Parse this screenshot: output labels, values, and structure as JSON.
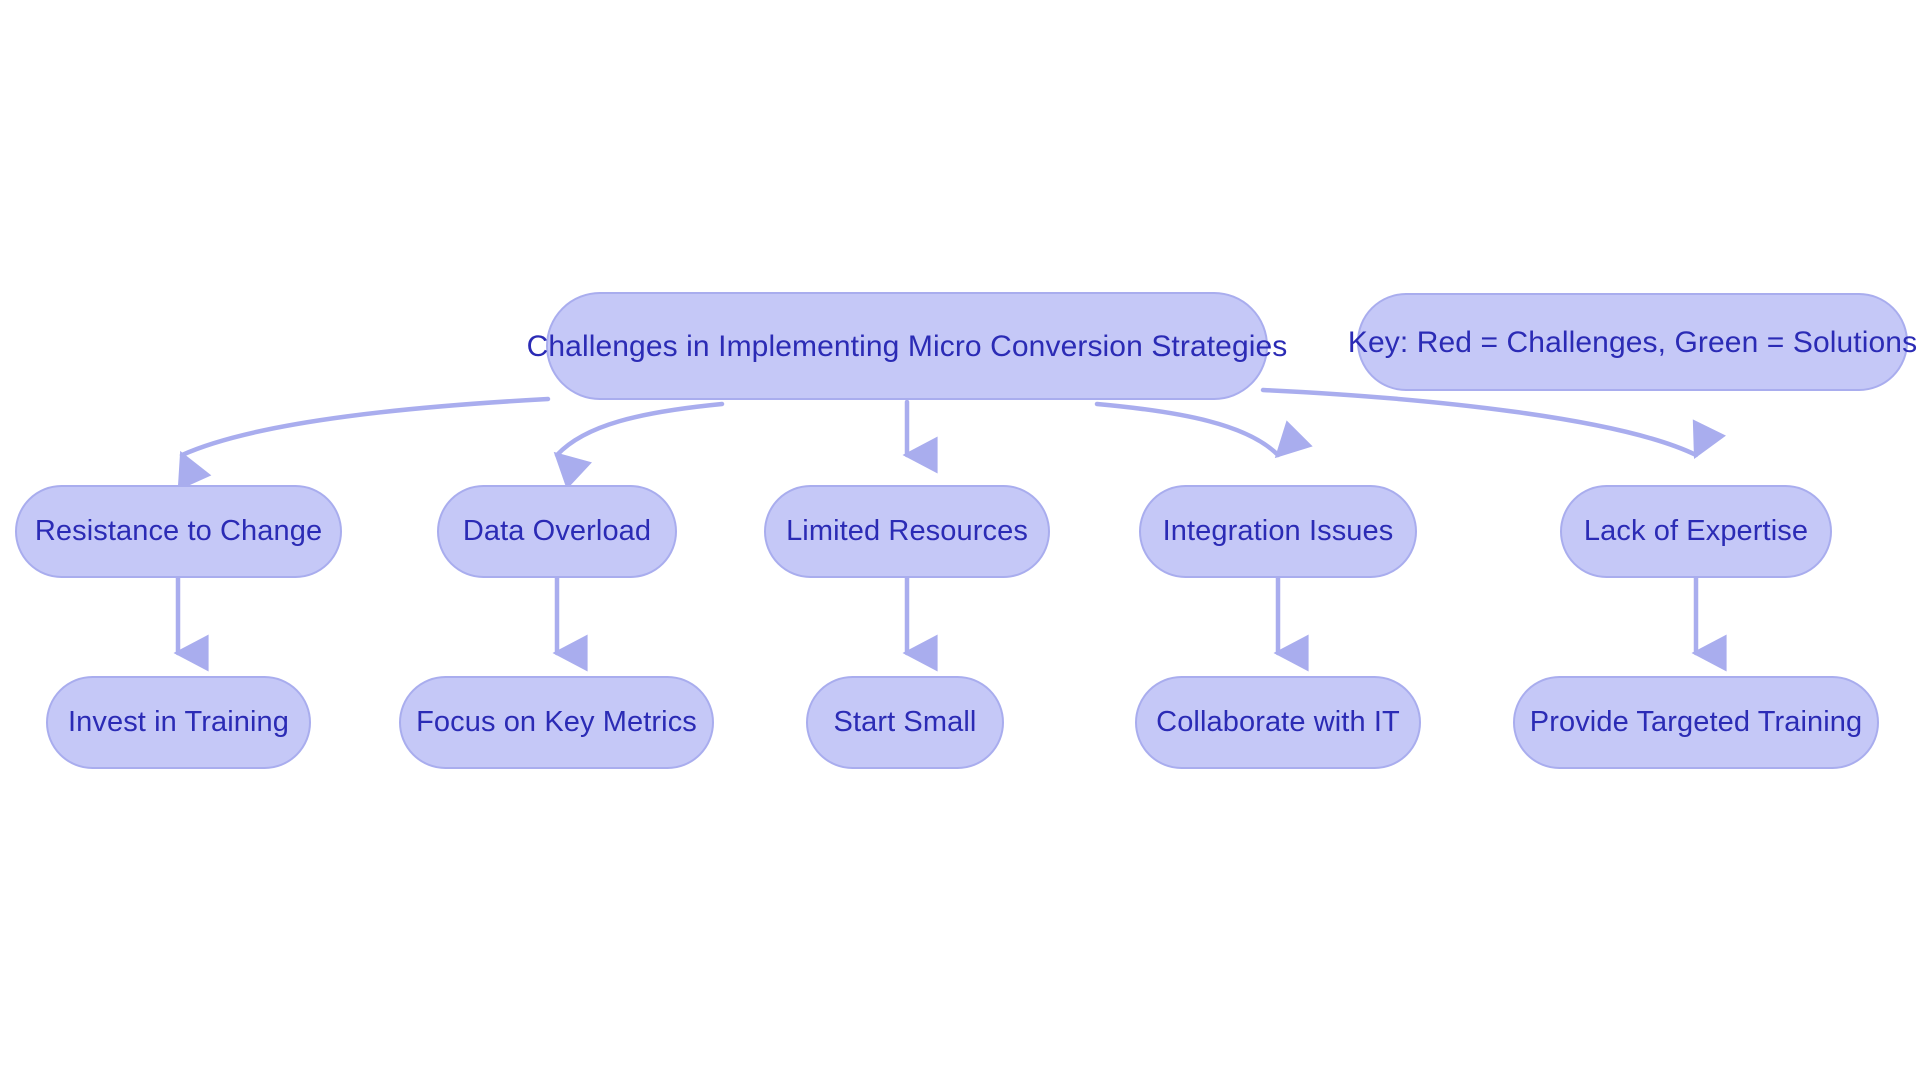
{
  "diagram": {
    "type": "flowchart",
    "orientation": "top-down",
    "background_color": "#ffffff",
    "node_fill_color": "#c5c8f7",
    "node_border_color": "#a9adee",
    "node_text_color": "#2b2bb5",
    "edge_color": "#a9adee",
    "root": {
      "id": "root",
      "label": "Challenges in Implementing Micro Conversion Strategies"
    },
    "key": {
      "id": "key",
      "label": "Key: Red = Challenges, Green =  Solutions"
    },
    "challenges": [
      {
        "id": "resistance-to-change",
        "label": "Resistance to Change"
      },
      {
        "id": "data-overload",
        "label": "Data Overload"
      },
      {
        "id": "limited-resources",
        "label": "Limited Resources"
      },
      {
        "id": "integration-issues",
        "label": "Integration Issues"
      },
      {
        "id": "lack-of-expertise",
        "label": "Lack of Expertise"
      }
    ],
    "solutions": [
      {
        "id": "invest-in-training",
        "label": "Invest in Training"
      },
      {
        "id": "focus-on-key-metrics",
        "label": "Focus on Key Metrics"
      },
      {
        "id": "start-small",
        "label": "Start Small"
      },
      {
        "id": "collaborate-with-it",
        "label": "Collaborate with IT"
      },
      {
        "id": "provide-targeted-training",
        "label": "Provide Targeted Training"
      }
    ],
    "edges": [
      {
        "from": "root",
        "to": "resistance-to-change"
      },
      {
        "from": "root",
        "to": "data-overload"
      },
      {
        "from": "root",
        "to": "limited-resources"
      },
      {
        "from": "root",
        "to": "integration-issues"
      },
      {
        "from": "root",
        "to": "lack-of-expertise"
      },
      {
        "from": "resistance-to-change",
        "to": "invest-in-training"
      },
      {
        "from": "data-overload",
        "to": "focus-on-key-metrics"
      },
      {
        "from": "limited-resources",
        "to": "start-small"
      },
      {
        "from": "integration-issues",
        "to": "collaborate-with-it"
      },
      {
        "from": "lack-of-expertise",
        "to": "provide-targeted-training"
      }
    ]
  }
}
